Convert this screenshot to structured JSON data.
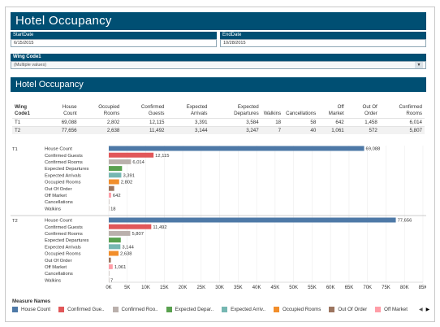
{
  "title": "Hotel Occupancy",
  "filters": {
    "start": {
      "label": "StartDate",
      "value": "6/15/2015"
    },
    "end": {
      "label": "EndDate",
      "value": "10/28/2015"
    },
    "wing": {
      "label": "Wing Code1",
      "value": "(Multiple values)"
    }
  },
  "summary": {
    "title": "Hotel Occupancy",
    "columns": [
      "Wing Code1",
      "House Count",
      "Occupied Rooms",
      "Confirmed Guests",
      "Expected Arrivals",
      "Expected Departures",
      "Walkins",
      "Cancellations",
      "Off Market",
      "Out Of Order",
      "Confirmed Rooms"
    ],
    "rows": [
      [
        "T1",
        "69,088",
        "2,802",
        "12,115",
        "3,391",
        "3,584",
        "18",
        "58",
        "642",
        "1,458",
        "6,014"
      ],
      [
        "T2",
        "77,656",
        "2,638",
        "11,492",
        "3,144",
        "3,247",
        "7",
        "40",
        "1,061",
        "572",
        "5,807"
      ]
    ]
  },
  "chart_data": {
    "type": "bar",
    "orientation": "horizontal",
    "xlim": [
      0,
      85000
    ],
    "x_ticks": [
      "0K",
      "5K",
      "10K",
      "15K",
      "20K",
      "25K",
      "30K",
      "35K",
      "40K",
      "45K",
      "50K",
      "55K",
      "60K",
      "65K",
      "70K",
      "75K",
      "80K",
      "85K"
    ],
    "panels": [
      {
        "name": "T1",
        "bars": [
          {
            "label": "House Count",
            "value": 69088,
            "display": "69,088",
            "color": "#4e79a7"
          },
          {
            "label": "Confirmed Guests",
            "value": 12115,
            "display": "12,115",
            "color": "#e15759"
          },
          {
            "label": "Confirmed Rooms",
            "value": 6014,
            "display": "6,014",
            "color": "#bab0ac"
          },
          {
            "label": "Expected Departures",
            "value": 3584,
            "display": "",
            "color": "#59a14f"
          },
          {
            "label": "Expected Arrivals",
            "value": 3391,
            "display": "3,391",
            "color": "#76b7b2"
          },
          {
            "label": "Occupied Rooms",
            "value": 2802,
            "display": "2,802",
            "color": "#f28e2b"
          },
          {
            "label": "Out Of Order",
            "value": 1458,
            "display": "",
            "color": "#9c755f"
          },
          {
            "label": "Off Market",
            "value": 642,
            "display": "642",
            "color": "#ff9da7"
          },
          {
            "label": "Cancellations",
            "value": 58,
            "display": "",
            "color": "#bab0ac"
          },
          {
            "label": "Walkins",
            "value": 18,
            "display": "18",
            "color": "#bab0ac"
          }
        ]
      },
      {
        "name": "T2",
        "bars": [
          {
            "label": "House Count",
            "value": 77656,
            "display": "77,656",
            "color": "#4e79a7"
          },
          {
            "label": "Confirmed Guests",
            "value": 11492,
            "display": "11,492",
            "color": "#e15759"
          },
          {
            "label": "Confirmed Rooms",
            "value": 5807,
            "display": "5,807",
            "color": "#bab0ac"
          },
          {
            "label": "Expected Departures",
            "value": 3247,
            "display": "",
            "color": "#59a14f"
          },
          {
            "label": "Expected Arrivals",
            "value": 3144,
            "display": "3,144",
            "color": "#76b7b2"
          },
          {
            "label": "Occupied Rooms",
            "value": 2638,
            "display": "2,638",
            "color": "#f28e2b"
          },
          {
            "label": "Out Of Order",
            "value": 572,
            "display": "",
            "color": "#9c755f"
          },
          {
            "label": "Off Market",
            "value": 1061,
            "display": "1,061",
            "color": "#ff9da7"
          },
          {
            "label": "Cancellations",
            "value": 40,
            "display": "",
            "color": "#bab0ac"
          },
          {
            "label": "Walkins",
            "value": 7,
            "display": "7",
            "color": "#bab0ac"
          }
        ]
      }
    ]
  },
  "legend": {
    "title": "Measure Names",
    "items": [
      {
        "label": "House Count",
        "color": "#4e79a7"
      },
      {
        "label": "Confirmed Gue..",
        "color": "#e15759"
      },
      {
        "label": "Confirmed Roo..",
        "color": "#bab0ac"
      },
      {
        "label": "Expected Depar..",
        "color": "#59a14f"
      },
      {
        "label": "Expected Arriv..",
        "color": "#76b7b2"
      },
      {
        "label": "Occupied Rooms",
        "color": "#f28e2b"
      },
      {
        "label": "Out Of Order",
        "color": "#9c755f"
      },
      {
        "label": "Off Market",
        "color": "#ff9da7"
      }
    ],
    "prev_icon": "prev-arrow-icon",
    "next_icon": "next-arrow-icon"
  }
}
